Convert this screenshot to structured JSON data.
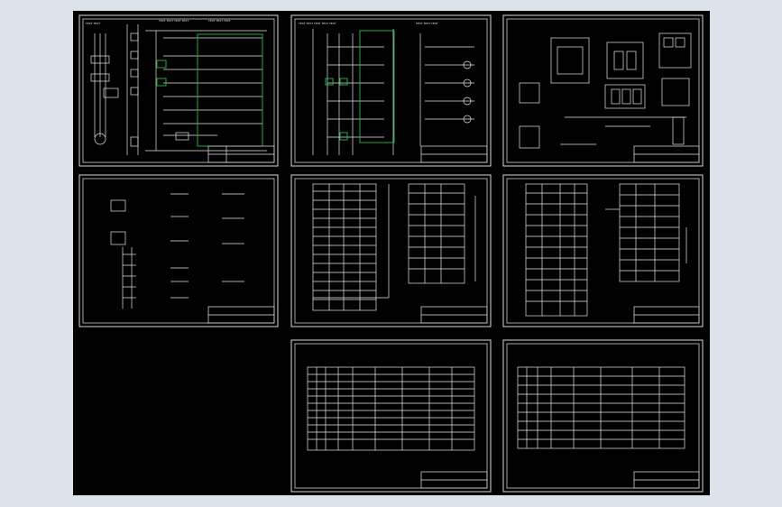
{
  "viewer": {
    "background_color": "#000000",
    "line_color": "#e6e6e6",
    "highlight_color": "#22c04a"
  },
  "sheets": [
    {
      "id": "sheet-1",
      "kind": "schematic-main"
    },
    {
      "id": "sheet-2",
      "kind": "schematic-control"
    },
    {
      "id": "sheet-3",
      "kind": "panel-layout"
    },
    {
      "id": "sheet-4",
      "kind": "schematic-aux"
    },
    {
      "id": "sheet-5",
      "kind": "terminal-table"
    },
    {
      "id": "sheet-6",
      "kind": "terminal-table"
    },
    {
      "id": "sheet-7",
      "kind": "parts-list"
    },
    {
      "id": "sheet-8",
      "kind": "parts-list"
    }
  ]
}
